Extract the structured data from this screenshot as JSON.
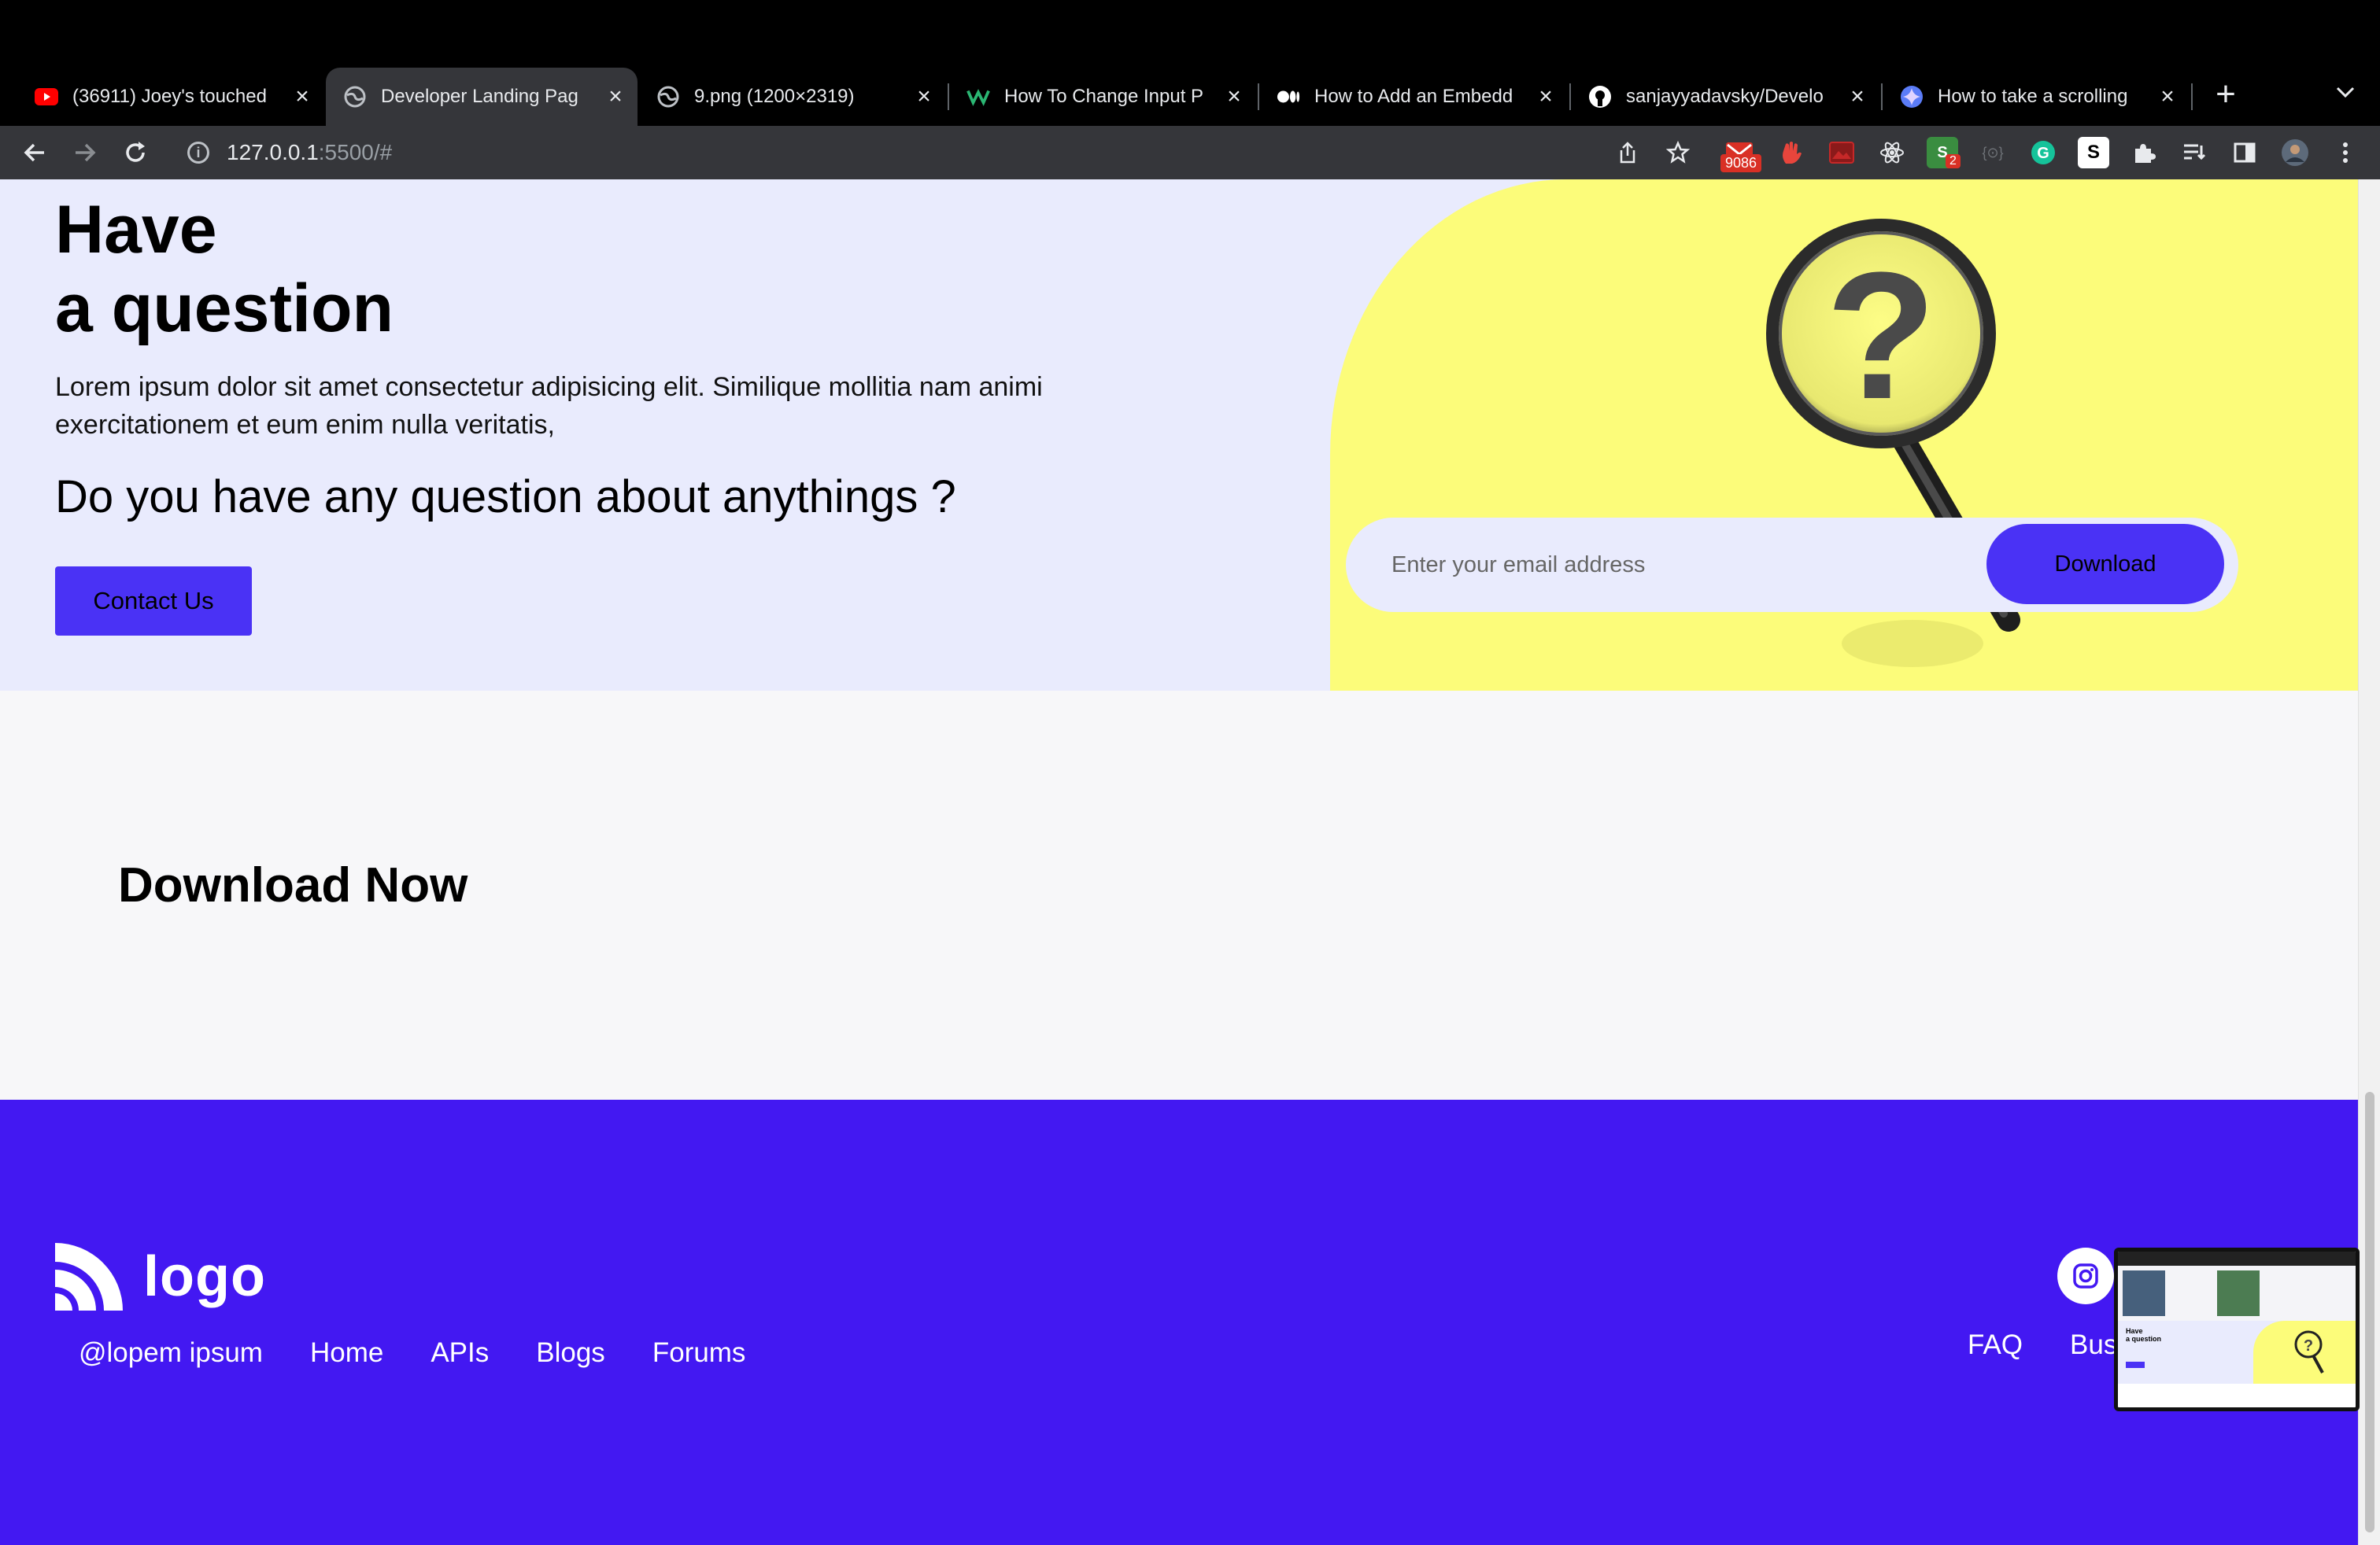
{
  "browser": {
    "tabs": [
      {
        "title": "(36911) Joey's touched",
        "icon": "youtube-icon"
      },
      {
        "title": "Developer Landing Pag",
        "icon": "globe-icon",
        "active": true
      },
      {
        "title": "9.png (1200×2319)",
        "icon": "globe-icon"
      },
      {
        "title": "How To Change Input P",
        "icon": "webflow-icon"
      },
      {
        "title": "How to Add an Embedd",
        "icon": "medium-icon"
      },
      {
        "title": "sanjayyadavsky/Develo",
        "icon": "github-icon"
      },
      {
        "title": "How to take a scrolling",
        "icon": "gemini-icon"
      }
    ],
    "url_host": "127.0.0.1",
    "url_rest": ":5500/#",
    "mail_badge": "9086",
    "ext_badge": "2"
  },
  "faq": {
    "title_line1": "Have",
    "title_line2": "a question",
    "description": "Lorem ipsum dolor sit amet consectetur adipisicing elit. Similique mollitia nam animi exercitationem et eum enim nulla veritatis,",
    "question": "Do you have any question about anythings ?",
    "contact_label": "Contact Us"
  },
  "download": {
    "title_bold": "Download",
    "title_rest": " Now",
    "email_placeholder": "Enter your email address",
    "button_label": "Download"
  },
  "footer": {
    "logo_text": "logo",
    "links": [
      "@lopem ipsum",
      "Home",
      "APIs",
      "Blogs",
      "Forums"
    ],
    "right_links": [
      "FAQ",
      "Bus"
    ]
  },
  "thumbnail_preview": {
    "title_line1": "Have",
    "title_line2": "a question"
  },
  "colors": {
    "accent": "#4a32f5",
    "footer_bg": "#4318f2",
    "faq_bg": "#e9ebfd",
    "yellow": "#fcfc7a"
  }
}
